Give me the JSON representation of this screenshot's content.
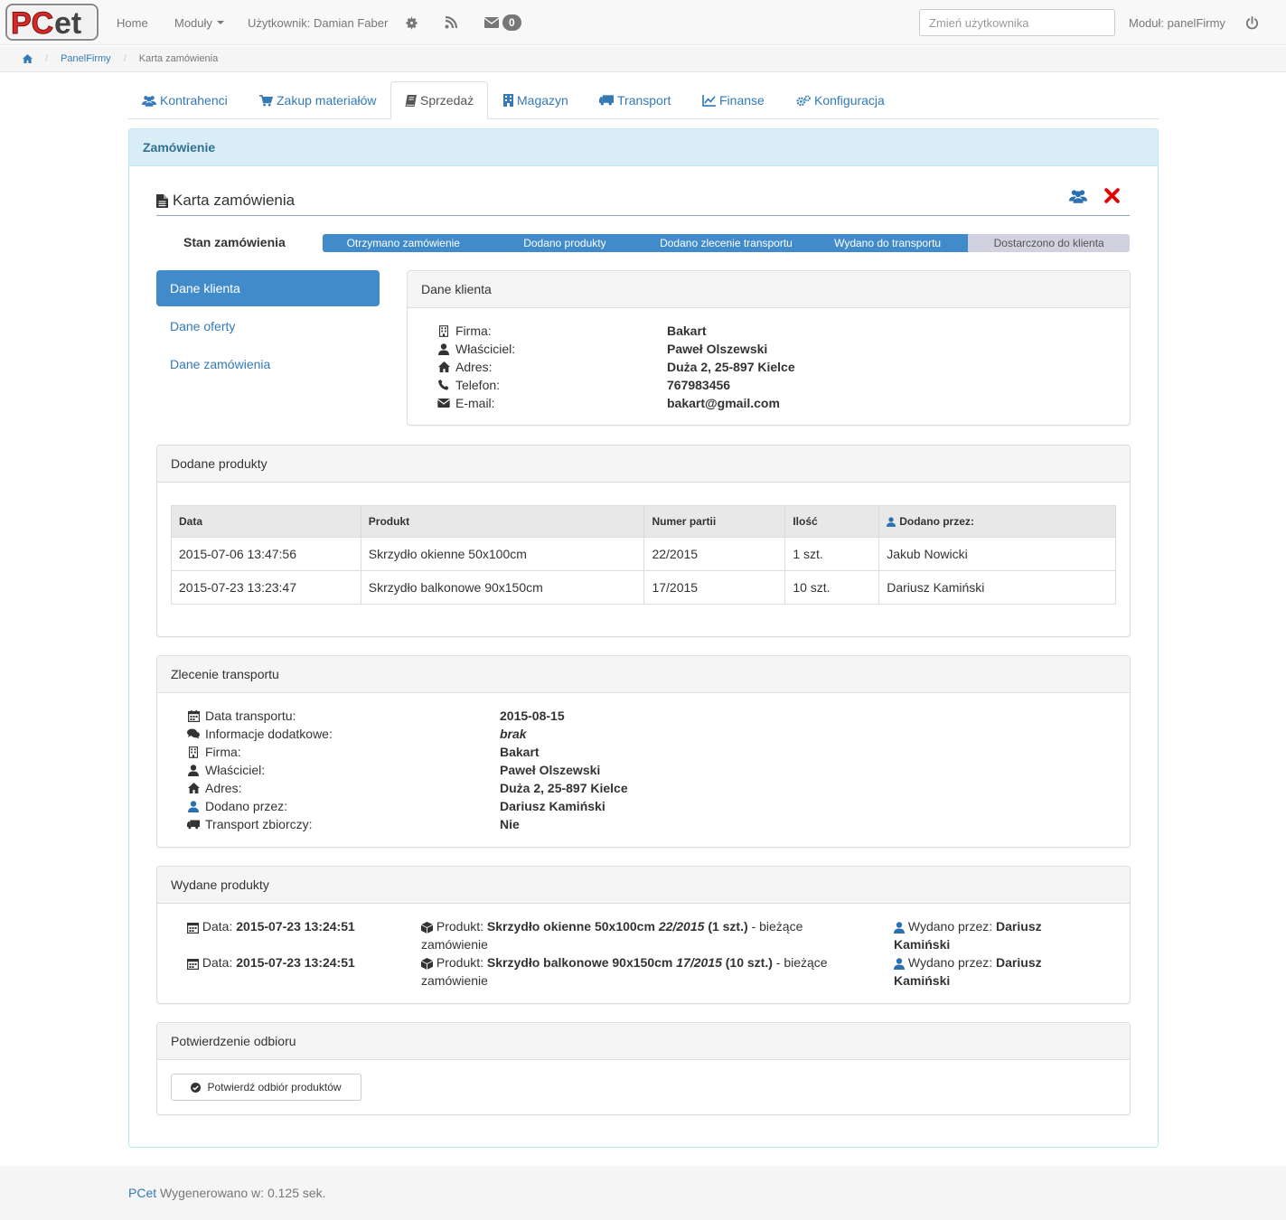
{
  "brand": {
    "logo_text_pc": "PC",
    "logo_text_et": "et",
    "logo_colors": {
      "red": "#d42a2a",
      "dark": "#333333"
    }
  },
  "navbar": {
    "home": "Home",
    "modules": "Moduły",
    "user": "Użytkownik: Damian Faber",
    "messages_count": "0",
    "switch_user_placeholder": "Zmień użytkownika",
    "module": "Moduł: panelFirmy"
  },
  "breadcrumb": {
    "item1": "PanelFirmy",
    "item2": "Karta zamówienia"
  },
  "tabs": [
    {
      "label": "Kontrahenci",
      "icon": "users-icon"
    },
    {
      "label": "Zakup materiałów",
      "icon": "cart-icon"
    },
    {
      "label": "Sprzedaż",
      "icon": "book-icon"
    },
    {
      "label": "Magazyn",
      "icon": "building-icon"
    },
    {
      "label": "Transport",
      "icon": "truck-icon"
    },
    {
      "label": "Finanse",
      "icon": "chart-icon"
    },
    {
      "label": "Konfiguracja",
      "icon": "gears-icon"
    }
  ],
  "panel": {
    "title": "Zamówienie"
  },
  "card": {
    "title": "Karta zamówienia"
  },
  "status": {
    "label": "Stan zamówienia",
    "completed_fraction": 0.8,
    "steps": [
      "Otrzymano zamówienie",
      "Dodano produkty",
      "Dodano zlecenie transportu",
      "Wydano do transportu",
      "Dostarczono do klienta"
    ]
  },
  "side_menu": [
    "Dane klienta",
    "Dane oferty",
    "Dane zamówienia"
  ],
  "client": {
    "title": "Dane klienta",
    "rows": [
      {
        "key": "Firma:",
        "value": "Bakart"
      },
      {
        "key": "Właściciel:",
        "value": "Paweł Olszewski"
      },
      {
        "key": "Adres:",
        "value": "Duża 2, 25-897 Kielce"
      },
      {
        "key": "Telefon:",
        "value": "767983456"
      },
      {
        "key": "E-mail:",
        "value": "bakart@gmail.com"
      }
    ]
  },
  "products": {
    "title": "Dodane produkty",
    "columns": [
      "Data",
      "Produkt",
      "Numer partii",
      "Ilość",
      "Dodano przez:"
    ],
    "rows": [
      [
        "2015-07-06 13:47:56",
        "Skrzydło okienne 50x100cm",
        "22/2015",
        "1 szt.",
        "Jakub Nowicki"
      ],
      [
        "2015-07-23 13:23:47",
        "Skrzydło balkonowe 90x150cm",
        "17/2015",
        "10 szt.",
        "Dariusz Kamiński"
      ]
    ]
  },
  "transport": {
    "title": "Zlecenie transportu",
    "rows": [
      {
        "key": "Data transportu:",
        "value": "2015-08-15"
      },
      {
        "key": "Informacje dodatkowe:",
        "value": "brak"
      },
      {
        "key": "Firma:",
        "value": "Bakart"
      },
      {
        "key": "Właściciel:",
        "value": "Paweł Olszewski"
      },
      {
        "key": "Adres:",
        "value": "Duża 2, 25-897 Kielce"
      },
      {
        "key": "Dodano przez:",
        "value": "Dariusz Kamiński"
      },
      {
        "key": "Transport zbiorczy:",
        "value": "Nie"
      }
    ]
  },
  "issued": {
    "title": "Wydane produkty",
    "date_label": "Data:",
    "product_label": "Produkt:",
    "suffix": "- bieżące zamówienie",
    "by_label": "Wydano przez:",
    "rows": [
      {
        "date": "2015-07-23 13:24:51",
        "product": "Skrzydło okienne 50x100cm",
        "batch": "22/2015",
        "qty": "(1 szt.)",
        "by": "Dariusz Kamiński"
      },
      {
        "date": "2015-07-23 13:24:51",
        "product": "Skrzydło balkonowe 90x150cm",
        "batch": "17/2015",
        "qty": "(10 szt.)",
        "by": "Dariusz Kamiński"
      }
    ]
  },
  "receipt": {
    "title": "Potwierdzenie odbioru",
    "button": "Potwierdź odbiór produktów"
  },
  "footer": {
    "brand": "PCet",
    "text": "Wygenerowano w: 0.125 sek."
  }
}
